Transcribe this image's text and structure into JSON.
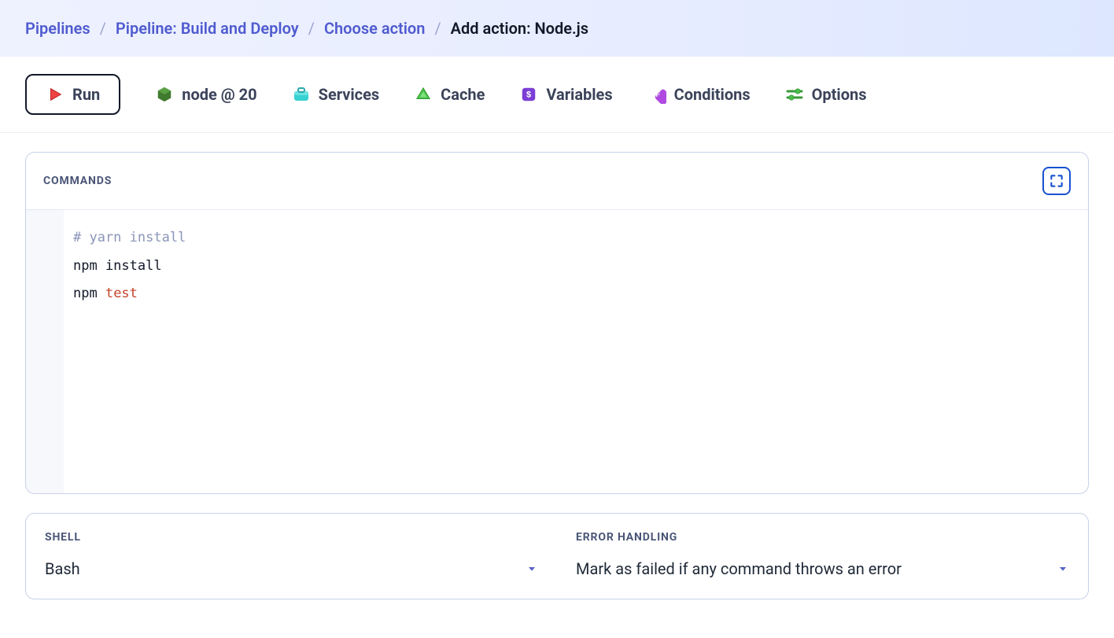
{
  "breadcrumb": {
    "items": [
      "Pipelines",
      "Pipeline: Build and Deploy",
      "Choose action"
    ],
    "current": "Add action: Node.js"
  },
  "tabs": {
    "run": "Run",
    "node": "node @ 20",
    "services": "Services",
    "cache": "Cache",
    "variables": "Variables",
    "conditions": "Conditions",
    "options": "Options"
  },
  "commands": {
    "title": "COMMANDS",
    "lines": [
      {
        "raw": "# yarn install",
        "tokens": [
          {
            "t": "comment",
            "s": "# yarn install"
          }
        ]
      },
      {
        "raw": "npm install",
        "tokens": [
          {
            "t": "plain",
            "s": "npm install"
          }
        ]
      },
      {
        "raw": "npm test",
        "tokens": [
          {
            "t": "plain",
            "s": "npm "
          },
          {
            "t": "builtin",
            "s": "test"
          }
        ]
      }
    ]
  },
  "shell": {
    "label": "SHELL",
    "value": "Bash"
  },
  "error": {
    "label": "ERROR HANDLING",
    "value": "Mark as failed if any command throws an error"
  }
}
